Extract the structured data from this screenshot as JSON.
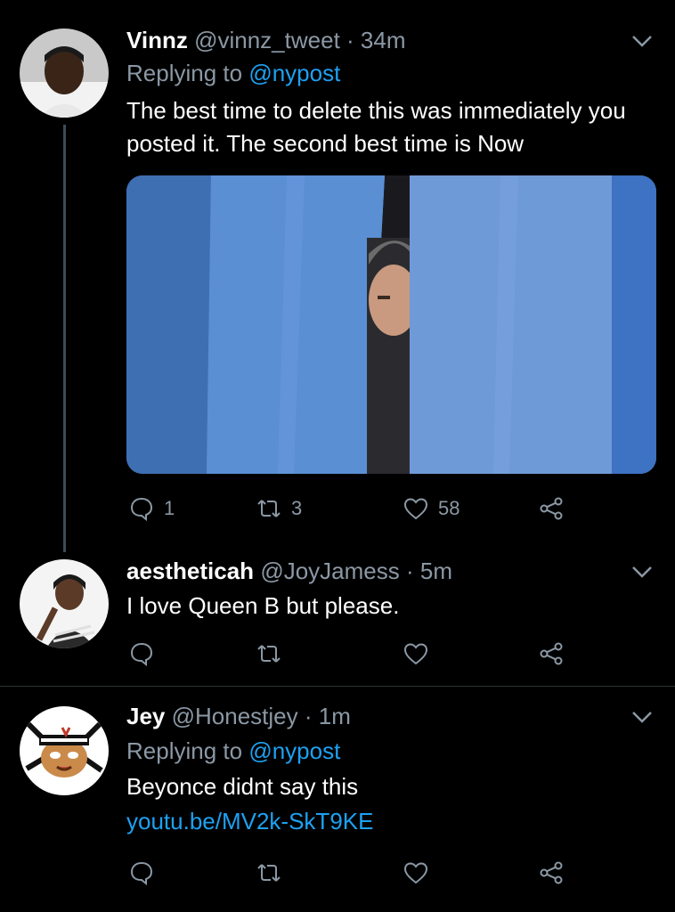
{
  "tweets": [
    {
      "display_name": "Vinnz",
      "handle": "@vinnz_tweet",
      "time": "· 34m",
      "replying_label": "Replying to",
      "replying_to": "@nypost",
      "text": "The best time to delete this was immediately you posted it. The second best time is Now",
      "counts": {
        "reply": "1",
        "retweet": "3",
        "like": "58"
      }
    },
    {
      "display_name": "aestheticah",
      "handle": "@JoyJamess",
      "time": "· 5m",
      "text": "I love Queen B but please."
    },
    {
      "display_name": "Jey",
      "handle": "@Honestjey",
      "time": "· 1m",
      "replying_label": "Replying to",
      "replying_to": "@nypost",
      "text": "Beyonce didnt say this",
      "link": "youtu.be/MV2k-SkT9KE"
    }
  ],
  "colors": {
    "background": "#000000",
    "muted_text": "#8b98a5",
    "accent": "#1da1f2",
    "thread_line": "#3d4b57"
  },
  "icons": [
    "chevron-down-icon",
    "reply-icon",
    "retweet-icon",
    "like-icon",
    "share-icon"
  ]
}
